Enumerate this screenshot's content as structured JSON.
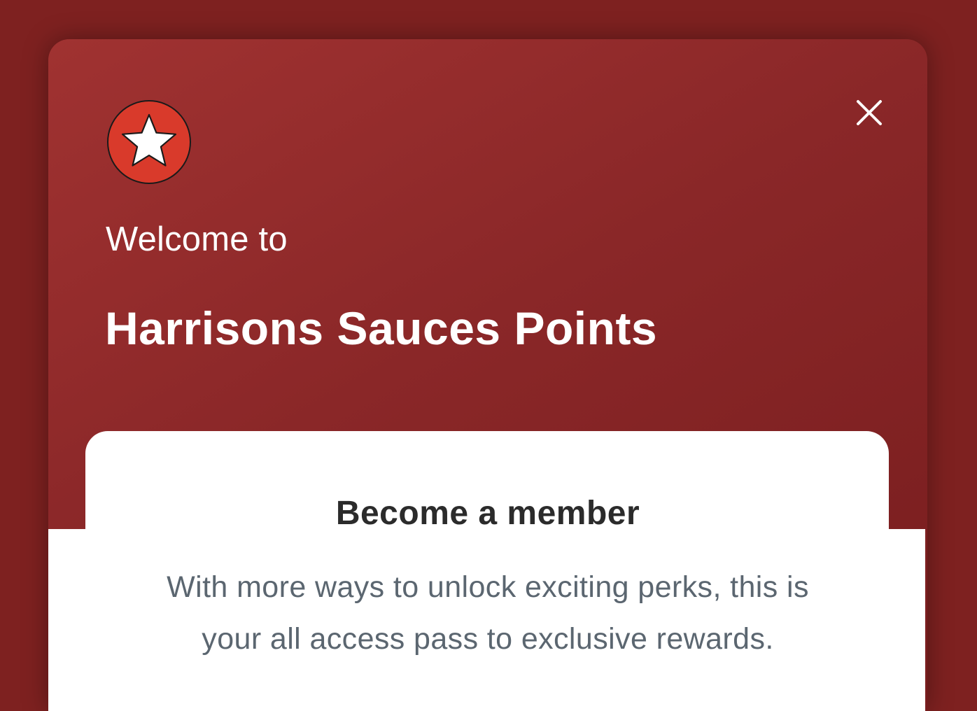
{
  "modal": {
    "welcome_text": "Welcome to",
    "program_name": "Harrisons Sauces Points",
    "logo_icon": "star-badge-icon",
    "close_icon": "close-icon"
  },
  "card": {
    "title": "Become a member",
    "description": "With more ways to unlock exciting perks, this is your all access pass to exclusive rewards."
  },
  "colors": {
    "brand_red": "#8a2728",
    "logo_red": "#d93a2b",
    "title_text": "#2b2b2b",
    "body_text": "#5b6670"
  }
}
